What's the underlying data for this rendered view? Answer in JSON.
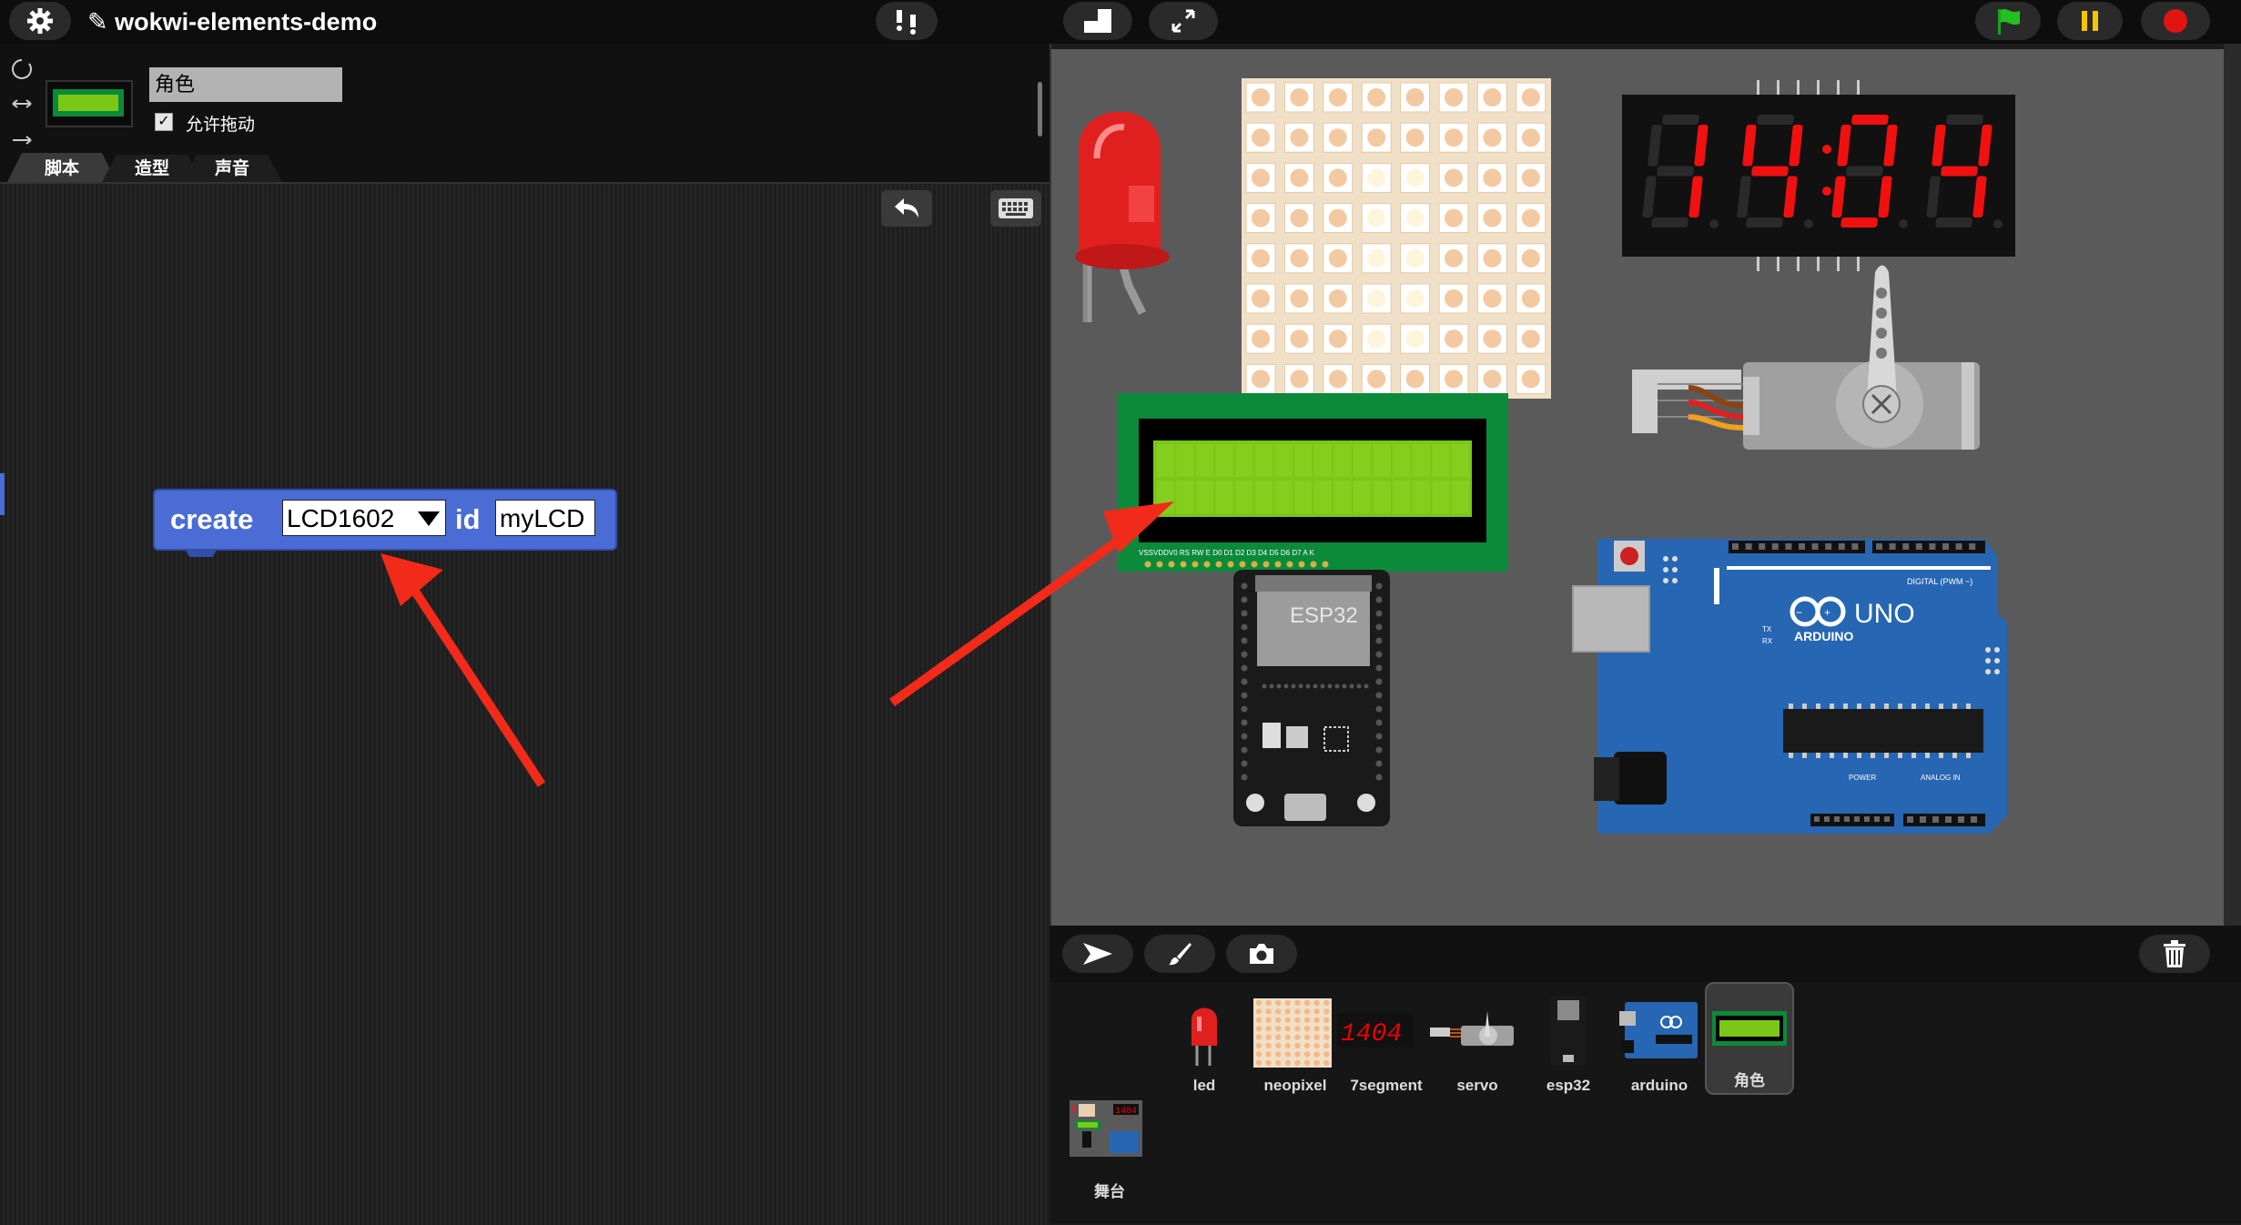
{
  "app": {
    "project_title": "✎ wokwi-elements-demo"
  },
  "sprite": {
    "name_value": "角色",
    "draggable_label": "允许拖动",
    "draggable_checked": true
  },
  "tabs": [
    {
      "label": "脚本",
      "active": true
    },
    {
      "label": "造型",
      "active": false
    },
    {
      "label": "声音",
      "active": false
    }
  ],
  "block": {
    "create_label": "create",
    "type_value": "LCD1602",
    "id_label": "id",
    "id_value": "myLCD"
  },
  "stage": {
    "seg_digits": "1404",
    "esp32_label": "ESP32",
    "uno_label": "UNO",
    "arduino_label": "ARDUINO",
    "digital_label": "DIGITAL (PWM ~)",
    "power_label": "POWER",
    "analog_label": "ANALOG IN",
    "tx_label": "TX",
    "rx_label": "RX",
    "lcd_pins_label": "VSSVDDV0 RS RW E D0 D1 D2 D3 D4 D5 D6 D7 A K"
  },
  "corral": {
    "sprites": [
      {
        "label": "led",
        "icon": "led-icon"
      },
      {
        "label": "neopixel",
        "icon": "neopixel-icon"
      },
      {
        "label": "7segment",
        "icon": "seven-segment-icon"
      },
      {
        "label": "servo",
        "icon": "servo-icon"
      },
      {
        "label": "esp32",
        "icon": "esp32-icon"
      },
      {
        "label": "arduino",
        "icon": "arduino-icon"
      },
      {
        "label": "角色",
        "icon": "lcd-icon",
        "selected": true
      }
    ],
    "stage_label": "舞台"
  },
  "colors": {
    "topbar": "#0d0d0d",
    "stage_bg": "#5a5a5a",
    "block_blue": "#4a6cd4",
    "lcd_green": "#7cc618",
    "led_red": "#e0201f",
    "arrow_red": "#f22a1a",
    "pcb_green": "#0b8a3a",
    "arduino_blue": "#2666b3"
  }
}
